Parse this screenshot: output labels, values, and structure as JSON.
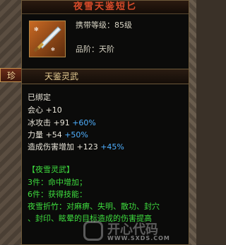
{
  "item": {
    "title": "夜雪天鉴短匕",
    "carry_level": "携带等级：85级",
    "grade": "品阶：天阶",
    "side_tab": "珍",
    "section": "天鉴灵武"
  },
  "stats": {
    "bound": "已绑定",
    "crit_label": "会心",
    "crit_value": "+10",
    "ice_label": "冰攻击",
    "ice_value": "+91",
    "ice_pct": "+60%",
    "str_label": "力量",
    "str_value": "+54",
    "str_pct": "+50%",
    "dmg_label": "造成伤害增加",
    "dmg_value": "+123",
    "dmg_pct": "+45%"
  },
  "set": {
    "name": "【夜雪灵武】",
    "p3_label": "3件：",
    "p3_value": "命中增加；",
    "p6_label": "6件：",
    "p6_value": "获得技能：",
    "skill_line1": "夜雪折竹：对麻痹、失明、散功、封穴",
    "skill_line2": "、封印、眩晕的目标造成的伤害提高"
  },
  "watermark": {
    "text": "开心代码",
    "url": "WWW.SXDS.COM"
  }
}
